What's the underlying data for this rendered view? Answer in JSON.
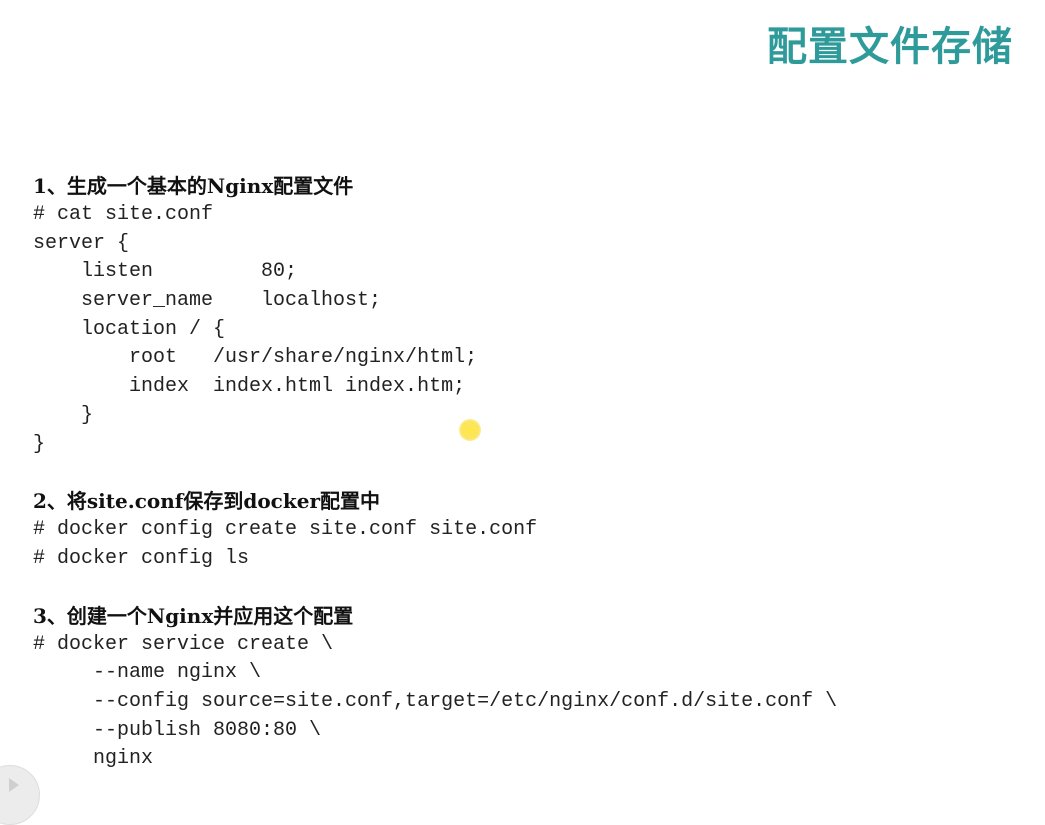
{
  "title": "配置文件存储",
  "sections": [
    {
      "heading": "1、生成一个基本的Nginx配置文件",
      "lines": [
        "# cat site.conf",
        "server {",
        "    listen         80;",
        "    server_name    localhost;",
        "    location / {",
        "        root   /usr/share/nginx/html;",
        "        index  index.html index.htm;",
        "    }",
        "}"
      ]
    },
    {
      "heading": "2、将site.conf保存到docker配置中",
      "lines": [
        "# docker config create site.conf site.conf",
        "# docker config ls"
      ]
    },
    {
      "heading": "3、创建一个Nginx并应用这个配置",
      "lines": [
        "# docker service create \\",
        "     --name nginx \\",
        "     --config source=site.conf,target=/etc/nginx/conf.d/site.conf \\",
        "     --publish 8080:80 \\",
        "     nginx"
      ]
    }
  ],
  "colors": {
    "title": "#2f9a9a",
    "cursor_highlight": "#f7dc3c"
  },
  "icons": {
    "cursor": "cursor-highlight-icon",
    "play": "play-icon"
  }
}
